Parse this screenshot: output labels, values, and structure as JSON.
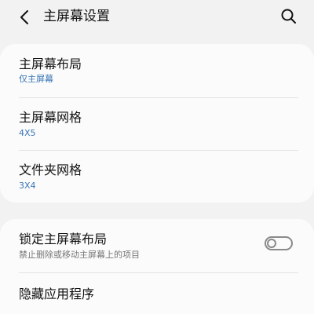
{
  "header": {
    "title": "主屏幕设置",
    "back_icon": "chevron-left-icon",
    "search_icon": "search-icon"
  },
  "settings": {
    "home_layout": {
      "title": "主屏幕布局",
      "value": "仅主屏幕"
    },
    "home_grid": {
      "title": "主屏幕网格",
      "value": "4X5"
    },
    "folder_grid": {
      "title": "文件夹网格",
      "value": "3X4"
    },
    "lock_layout": {
      "title": "锁定主屏幕布局",
      "description": "禁止删除或移动主屏幕上的项目",
      "enabled": false
    },
    "hide_apps": {
      "title": "隐藏应用程序"
    }
  },
  "colors": {
    "accent": "#3a76b5",
    "background": "#f2f2f2",
    "card": "#fbfbfb"
  }
}
